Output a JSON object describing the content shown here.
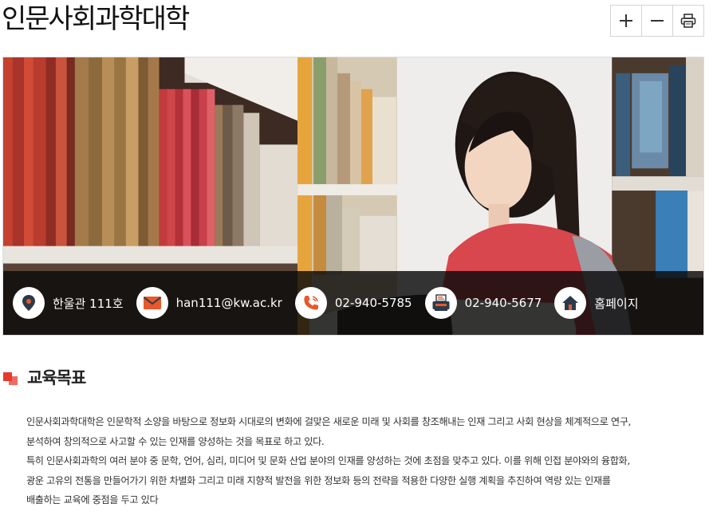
{
  "page": {
    "title": "인문사회과학대학"
  },
  "toolbar": {
    "zoom_in_label": "+",
    "zoom_out_label": "−",
    "print_label": "print"
  },
  "info": {
    "location": "한울관 111호",
    "email": "han111@kw.ac.kr",
    "phone": "02-940-5785",
    "fax": "02-940-5677",
    "homepage": "홈페이지"
  },
  "section": {
    "title": "교육목표",
    "lines": [
      "인문사회과학대학은 인문학적 소양을 바탕으로 정보화 시대로의 변화에 걸맞은 새로운 미래 및 사회를 창조해내는 인재 그리고 사회 현상을 체계적으로 연구,",
      "분석하여 창의적으로 사고할 수 있는 인재를 양성하는 것을 목표로 하고 있다.",
      "특히 인문사회과학의 여러 분야 중 문학, 언어, 심리, 미디어 및 문화 산업 분야의 인재를 양성하는 것에 초점을 맞추고 있다. 이를 위해 인접 분야와의 융합화,",
      "광운 고유의 전통을 만들어가기 위한 차별화 그리고 미래 지향적 발전을 위한 정보화 등의 전략을 적용한 다양한 실행 계획을 추진하여 역량 있는 인재를",
      "배출하는 교육에 중점을 두고 있다"
    ]
  },
  "colors": {
    "accent": "#e8392c",
    "icon_orange": "#e8582a",
    "icon_dark": "#2b3a4a"
  }
}
